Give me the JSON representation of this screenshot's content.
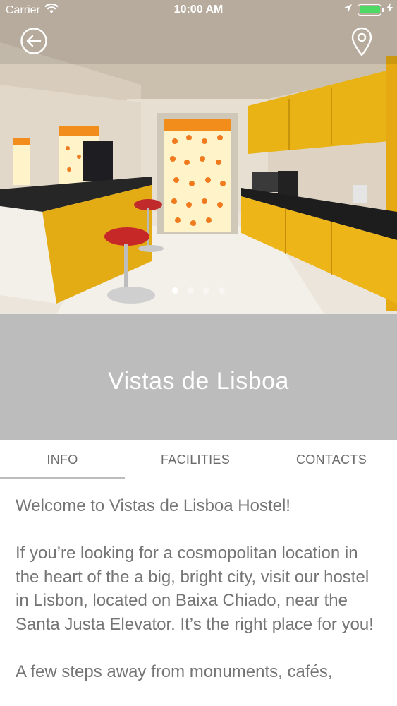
{
  "status_bar": {
    "carrier": "Carrier",
    "time": "10:00 AM"
  },
  "hero": {
    "slides_total": 4,
    "active_slide": 1
  },
  "title": "Vistas de Lisboa",
  "tabs": [
    {
      "label": "INFO",
      "active": true
    },
    {
      "label": "FACILITIES",
      "active": false
    },
    {
      "label": "CONTACTS",
      "active": false
    }
  ],
  "content": {
    "paragraphs": [
      "Welcome to Vistas de Lisboa Hostel!",
      "If you’re looking for a cosmopolitan location in the heart of the a big, bright city, visit our hostel in Lisbon, located on Baixa Chiado, near the Santa Justa Elevator. It’s the right place for you!",
      "A few steps away from monuments, cafés,"
    ]
  },
  "colors": {
    "title_band": "#bdbcbd",
    "body_text": "#757575",
    "tab_text": "#6b6b6b",
    "battery": "#4cd964"
  },
  "icons": {
    "back": "arrow-left-circle-icon",
    "location": "map-pin-icon",
    "wifi": "wifi-icon",
    "location_arrow": "location-arrow-icon",
    "charging": "bolt-icon"
  }
}
